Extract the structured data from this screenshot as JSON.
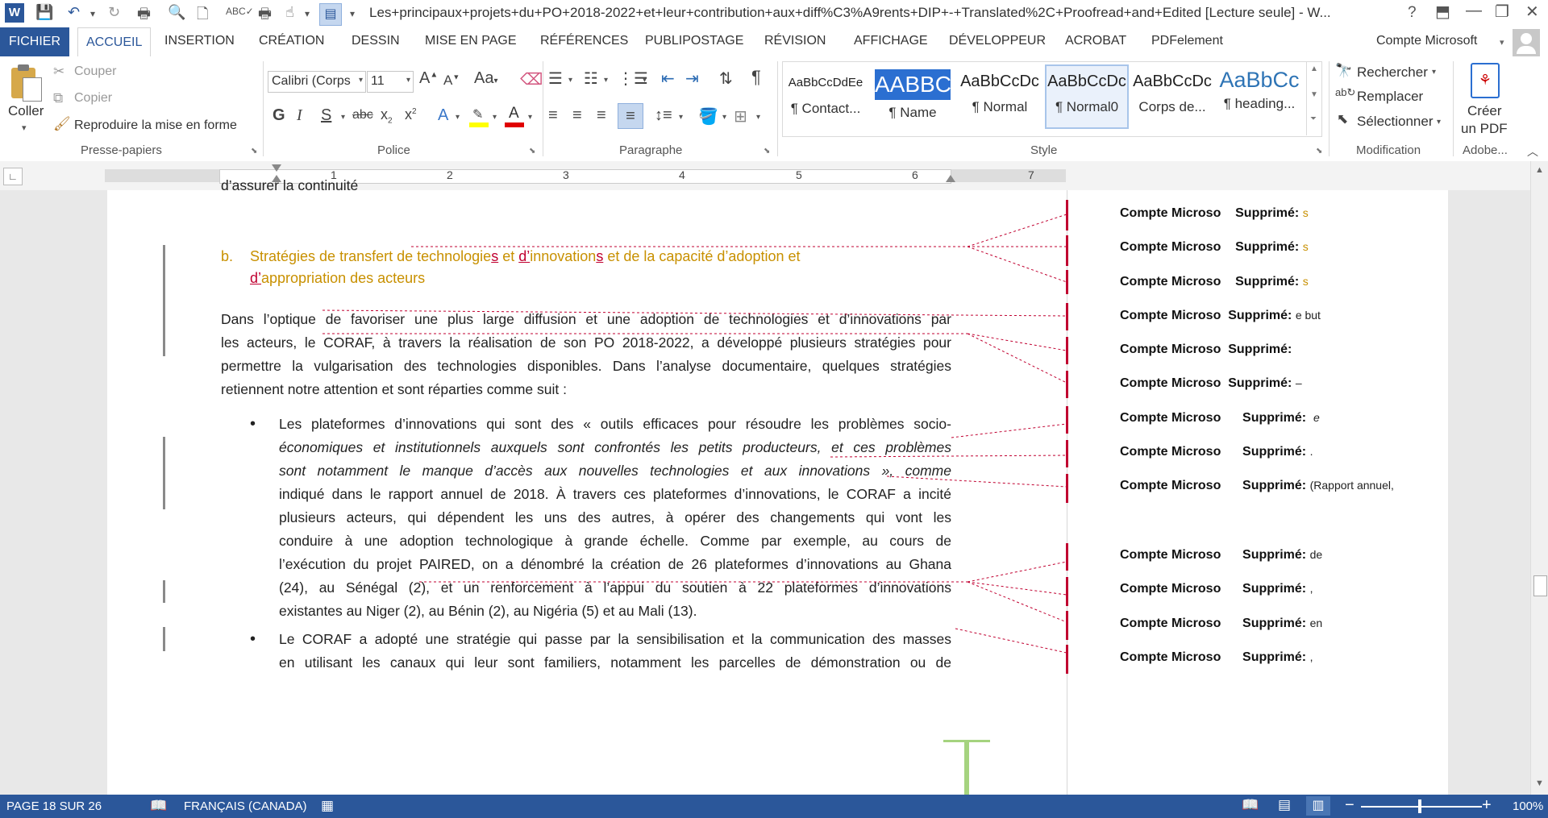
{
  "titlebar": {
    "title": "Les+principaux+projets+du+PO+2018-2022+et+leur+contribution+aux+diff%C3%A9rents+DIP+-+Translated%2C+Proofread+and+Edited [Lecture seule] - W...",
    "help": "?"
  },
  "tabs": [
    "FICHIER",
    "ACCUEIL",
    "INSERTION",
    "CRÉATION",
    "DESSIN",
    "MISE EN PAGE",
    "RÉFÉRENCES",
    "PUBLIPOSTAGE",
    "RÉVISION",
    "AFFICHAGE",
    "DÉVELOPPEUR",
    "ACROBAT",
    "PDFelement"
  ],
  "account": "Compte Microsoft",
  "ribbon": {
    "clipboard": {
      "paste": "Coller",
      "cut": "Couper",
      "copy": "Copier",
      "format_painter": "Reproduire la mise en forme",
      "label": "Presse-papiers"
    },
    "font": {
      "name": "Calibri (Corps",
      "size": "11",
      "label": "Police",
      "bold": "G",
      "italic": "I",
      "underline": "S"
    },
    "paragraph": {
      "label": "Paragraphe"
    },
    "styles": {
      "label": "Style",
      "items": [
        {
          "sample": "AaBbCcDdEe",
          "name": "¶ Contact..."
        },
        {
          "sample": "AABBC",
          "name": "¶ Name"
        },
        {
          "sample": "AaBbCcDc",
          "name": "¶ Normal"
        },
        {
          "sample": "AaBbCcDc",
          "name": "¶ Normal0"
        },
        {
          "sample": "AaBbCcDc",
          "name": "Corps de..."
        },
        {
          "sample": "AaBbCc",
          "name": "¶ heading..."
        }
      ]
    },
    "editing": {
      "find": "Rechercher",
      "replace": "Remplacer",
      "select": "Sélectionner",
      "label": "Modification"
    },
    "adobe": {
      "create_pdf_1": "Créer",
      "create_pdf_2": "un PDF",
      "label": "Adobe..."
    }
  },
  "ruler": {
    "numbers": [
      "1",
      "2",
      "3",
      "4",
      "5",
      "6",
      "7"
    ]
  },
  "document": {
    "top_fragment": "d’assurer la continuité",
    "heading_letter": "b.",
    "heading_line1_a": "Stratégies de transfert de technologie",
    "heading_line1_b": "s",
    "heading_line1_c": " et ",
    "heading_line1_d": "d’",
    "heading_line1_e": "innovation",
    "heading_line1_f": "s",
    "heading_line1_g": " et de la capacité d’adoption et",
    "heading_line2_a": "d’",
    "heading_line2_b": "appropriation des acteurs",
    "p1": [
      "Dans l’optique de favoriser une plus large diffusion et une adoption de technologies et d’innovations par",
      "les acteurs, le CORAF, à travers la réalisation de son PO 2018-2022, a développé plusieurs stratégies pour",
      "permettre la vulgarisation des technologies disponibles. Dans l’analyse documentaire, quelques stratégies",
      "retiennent notre attention et sont réparties comme suit :"
    ],
    "b1": [
      "Les plateformes d’innovations qui sont des « outils efficaces pour résoudre les problèmes socio-",
      "économiques et institutionnels auxquels sont confrontés les petits producteurs, et ces problèmes",
      "sont notamment le manque d’accès aux nouvelles technologies et aux innovations », comme",
      "indiqué dans le rapport annuel de 2018. À travers ces plateformes d’innovations, le CORAF a incité",
      "plusieurs acteurs, qui dépendent les uns des autres, à opérer des changements qui vont les",
      "conduire à une adoption technologique à grande échelle. Comme par exemple, au cours de",
      "l’exécution du projet PAIRED, on a dénombré la création de 26 plateformes d’innovations au Ghana",
      "(24), au Sénégal (2), et un renforcement à l’appui du soutien à 22 plateformes d’innovations",
      "existantes au Niger (2), au Bénin (2), au Nigéria (5) et au Mali (13)."
    ],
    "b2": [
      "Le CORAF a adopté une stratégie qui passe par la sensibilisation et la communication des masses",
      "en utilisant les canaux qui leur sont familiers, notamment les parcelles de démonstration ou de"
    ]
  },
  "balloons": [
    {
      "author": "Compte Microso",
      "label": "Supprimé:",
      "text": "s"
    },
    {
      "author": "Compte Microso",
      "label": "Supprimé:",
      "text": "s"
    },
    {
      "author": "Compte Microso",
      "label": "Supprimé:",
      "text": "s"
    },
    {
      "author": "Compte Microso",
      "label": "Supprimé:",
      "text": "e but"
    },
    {
      "author": "Compte Microso",
      "label": "Supprimé:",
      "text": ""
    },
    {
      "author": "Compte Microso",
      "label": "Supprimé:",
      "text": "–"
    },
    {
      "author": "Compte Microso",
      "label": "Supprimé:",
      "text": "e"
    },
    {
      "author": "Compte Microso",
      "label": "Supprimé:",
      "text": "."
    },
    {
      "author": "Compte Microso",
      "label": "Supprimé:",
      "text": "(Rapport annuel,"
    },
    {
      "author": "Compte Microso",
      "label": "Supprimé:",
      "text": "de"
    },
    {
      "author": "Compte Microso",
      "label": "Supprimé:",
      "text": ","
    },
    {
      "author": "Compte Microso",
      "label": "Supprimé:",
      "text": "en"
    },
    {
      "author": "Compte Microso",
      "label": "Supprimé:",
      "text": ","
    }
  ],
  "statusbar": {
    "page": "PAGE 18 SUR 26",
    "language": "FRANÇAIS (CANADA)",
    "zoom": "100%"
  }
}
